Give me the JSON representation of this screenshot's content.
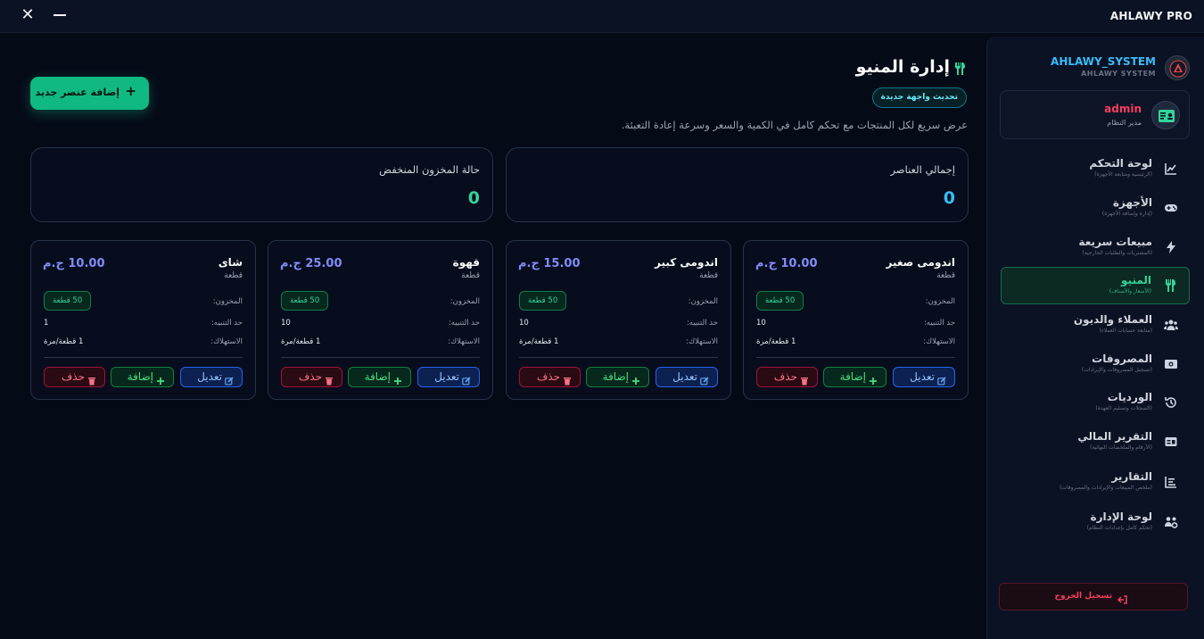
{
  "titlebar": {
    "app_title": "AHLAWY PRO"
  },
  "sidebar": {
    "brand_name": "AHLAWY_SYSTEM",
    "brand_sub": "AHLAWY SYSTEM",
    "user": {
      "name": "admin",
      "role": "مدير النظام"
    },
    "items": [
      {
        "label": "لوحة التحكم",
        "sub": "(الرئيسية ومتابعة الأجهزة)",
        "icon": "chart-line-icon"
      },
      {
        "label": "الأجهزة",
        "sub": "(إدارة وإضافة الأجهزة)",
        "icon": "gamepad-icon"
      },
      {
        "label": "مبيعات سريعة",
        "sub": "(المشتريات والطلبات الخارجية)",
        "icon": "bolt-icon"
      },
      {
        "label": "المنيو",
        "sub": "(الأسعار والأصناف)",
        "icon": "utensils-icon",
        "active": true
      },
      {
        "label": "العملاء والديون",
        "sub": "(متابعة حسابات العملاء)",
        "icon": "users-icon"
      },
      {
        "label": "المصروفات",
        "sub": "(تسجيل المصروفات والإيرادات)",
        "icon": "money-icon"
      },
      {
        "label": "الورديات",
        "sub": "(السجلات وتسليم العهدة)",
        "icon": "history-icon"
      },
      {
        "label": "التقرير المالي",
        "sub": "(الأرقام والملخصات النهائية)",
        "icon": "receipt-icon"
      },
      {
        "label": "التقارير",
        "sub": "(ملخص المبيعات والإيرادات والمصروفات)",
        "icon": "report-icon"
      },
      {
        "label": "لوحة الإدارة",
        "sub": "(تحكم كامل بإعدادات النظام)",
        "icon": "users-cog-icon"
      }
    ],
    "logout_label": "تسجيل الخروج"
  },
  "main": {
    "title": "إدارة المنيو",
    "badge": "تحديث واجهة جديدة",
    "description": "عرض سريع لكل المنتجات مع تحكم كامل في الكمية والسعر وسرعة إعادة التعبئة.",
    "add_button": "إضافة عنصر جديد",
    "stats": [
      {
        "label": "إجمالي العناصر",
        "value": "0",
        "color": "#38bdf8"
      },
      {
        "label": "حالة المخزون المنخفض",
        "value": "0",
        "color": "#34d399"
      }
    ],
    "row_labels": {
      "stock": "المخزون:",
      "alert": "حد التنبيه:",
      "consumption": "الاستهلاك:"
    },
    "buttons": {
      "edit": "تعديل",
      "add": "إضافة",
      "delete": "حذف"
    },
    "items": [
      {
        "name": "اندومى صغير",
        "unit": "قطعة",
        "price": "10.00 ج.م",
        "stock": "50 قطعة",
        "alert": "10",
        "consumption": "1 قطعة/مرة"
      },
      {
        "name": "اندومى كبير",
        "unit": "قطعة",
        "price": "15.00 ج.م",
        "stock": "50 قطعة",
        "alert": "10",
        "consumption": "1 قطعة/مرة"
      },
      {
        "name": "قهوة",
        "unit": "قطعة",
        "price": "25.00 ج.م",
        "stock": "50 قطعة",
        "alert": "10",
        "consumption": "1 قطعة/مرة"
      },
      {
        "name": "شاى",
        "unit": "قطعة",
        "price": "10.00 ج.م",
        "stock": "50 قطعة",
        "alert": "1",
        "consumption": "1 قطعة/مرة"
      }
    ]
  }
}
